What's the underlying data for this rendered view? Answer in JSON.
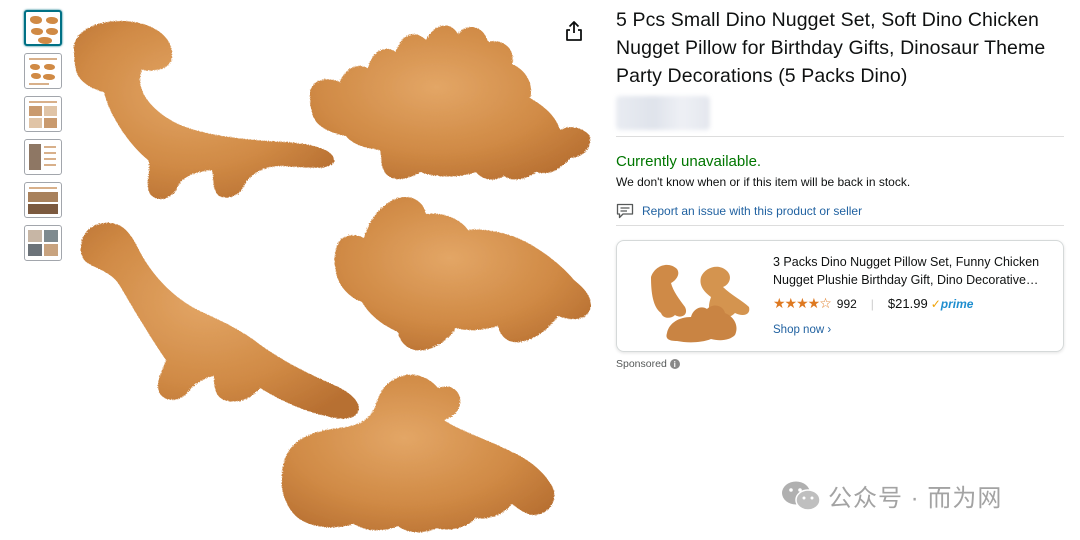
{
  "product": {
    "title": "5 Pcs Small Dino Nugget Set, Soft Dino Chicken Nugget Pillow for Birthday Gifts, Dinosaur Theme Party Decorations (5 Packs Dino)",
    "availability": "Currently unavailable.",
    "availability_note": "We don't know when or if this item will be back in stock.",
    "report_issue": "Report an issue with this product or seller"
  },
  "thumbnails": [
    {
      "label": "thumbnail-1",
      "selected": true
    },
    {
      "label": "thumbnail-2",
      "selected": false
    },
    {
      "label": "thumbnail-3",
      "selected": false
    },
    {
      "label": "thumbnail-4",
      "selected": false
    },
    {
      "label": "thumbnail-5",
      "selected": false
    },
    {
      "label": "thumbnail-6",
      "selected": false
    }
  ],
  "sponsored": {
    "title": "3 Packs Dino Nugget Pillow Set, Funny Chicken Nugget Plushie Birthday Gift, Dino Decorative…",
    "stars": "★★★★☆",
    "rating_count": "992",
    "separator": "|",
    "price": "$21.99",
    "prime_label": "prime",
    "shop_now": "Shop now ›",
    "label": "Sponsored",
    "info_icon": "i"
  },
  "watermark": {
    "text": "公众号 · 而为网"
  },
  "colors": {
    "nugget": "#d08a45",
    "availability_green": "#007600",
    "link_blue": "#2162a1",
    "star_orange": "#de7921",
    "prime_blue": "#1f8ecf"
  },
  "icons": {
    "share": "share-icon",
    "report": "chat-bubble-icon",
    "wechat": "wechat-icon",
    "info": "info-icon"
  }
}
